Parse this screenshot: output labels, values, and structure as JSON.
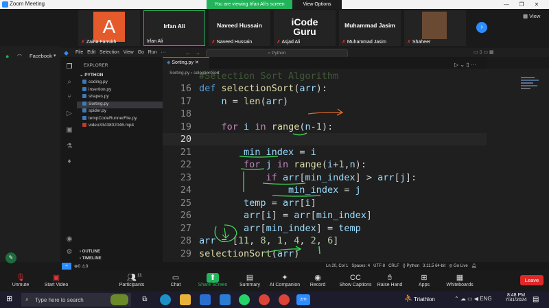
{
  "zoom": {
    "title": "Zoom Meeting",
    "share_banner": "You are viewing Irfan Ali's screen",
    "view_options": "View Options",
    "view_label": "View",
    "participants_strip": [
      {
        "tile_name": "",
        "caption": "Zaina Farrukh",
        "initial": "A",
        "muted": true
      },
      {
        "tile_name": "Irfan Ali",
        "caption": "Irfan Ali",
        "muted": false
      },
      {
        "tile_name": "Naveed Hussain",
        "caption": "Naveed Hussain",
        "muted": true
      },
      {
        "tile_name": "iCode Guru",
        "caption": "Asjad Ali",
        "muted": true
      },
      {
        "tile_name": "Muhammad Jasim",
        "caption": "Muhammad Jasim",
        "muted": true
      },
      {
        "tile_name": "",
        "caption": "Shaheer",
        "muted": true
      }
    ],
    "left_panel": {
      "profile": "Facebook"
    },
    "toolbar": [
      {
        "icon": "mic-off-icon",
        "label": "Unmute"
      },
      {
        "icon": "video-off-icon",
        "label": "Start Video"
      },
      {
        "icon": "participants-icon",
        "label": "Participants",
        "count": "11"
      },
      {
        "icon": "chat-icon",
        "label": "Chat"
      },
      {
        "icon": "share-screen-icon",
        "label": "Share Screen"
      },
      {
        "icon": "summary-icon",
        "label": "Summary"
      },
      {
        "icon": "ai-companion-icon",
        "label": "AI Companion"
      },
      {
        "icon": "record-icon",
        "label": "Record"
      },
      {
        "icon": "captions-icon",
        "label": "Show Captions"
      },
      {
        "icon": "raise-hand-icon",
        "label": "Raise Hand"
      },
      {
        "icon": "apps-icon",
        "label": "Apps"
      },
      {
        "icon": "whiteboard-icon",
        "label": "Whiteboards"
      }
    ],
    "leave": "Leave",
    "accent": "#23b35a"
  },
  "vscode": {
    "menu": [
      "File",
      "Edit",
      "Selection",
      "View",
      "Go",
      "Run",
      "···"
    ],
    "search_placeholder": "Python",
    "explorer_title": "EXPLORER",
    "folder": "PYTHON",
    "files": [
      {
        "name": "coding.py",
        "active": false
      },
      {
        "name": "insertion.py",
        "active": false
      },
      {
        "name": "shapes.py",
        "active": false
      },
      {
        "name": "Sorting.py",
        "active": true
      },
      {
        "name": "spider.py",
        "active": false
      },
      {
        "name": "tempCodeRunnerFile.py",
        "active": false
      },
      {
        "name": "video3343802046.mp4",
        "active": false
      }
    ],
    "outline": "OUTLINE",
    "timeline": "TIMELINE",
    "tab": "Sorting.py",
    "breadcrumb": [
      "Sorting.py",
      "selectionSort"
    ],
    "status": {
      "errors": "0",
      "warnings": "0",
      "position": "Ln 20, Col 1",
      "spaces": "Spaces: 4",
      "encoding": "UTF-8",
      "eol": "CRLF",
      "language": "Python",
      "version": "3.11.5 64-bit",
      "golive": "Go Live"
    },
    "code": [
      {
        "n": "16",
        "t": "def selectionSort(arr):"
      },
      {
        "n": "17",
        "t": "    n = len(arr)"
      },
      {
        "n": "18",
        "t": ""
      },
      {
        "n": "19",
        "t": "    for i in range(n-1):"
      },
      {
        "n": "20",
        "t": ""
      },
      {
        "n": "21",
        "t": "        min_index = i"
      },
      {
        "n": "22",
        "t": "        for j in range(i+1,n):"
      },
      {
        "n": "23",
        "t": "            if arr[min_index] > arr[j]:"
      },
      {
        "n": "24",
        "t": "                min_index = j"
      },
      {
        "n": "25",
        "t": "        temp = arr[i]"
      },
      {
        "n": "26",
        "t": "        arr[i] = arr[min_index]"
      },
      {
        "n": "27",
        "t": "        arr[min_index] = temp"
      },
      {
        "n": "28",
        "t": "arr = [11, 8, 1, 4, 2, 6]"
      },
      {
        "n": "29",
        "t": "selectionSort(arr)"
      }
    ],
    "top_partial": "#Selection Sort Algorithm"
  },
  "taskbar": {
    "search_placeholder": "Type here to search",
    "weather": "Triathlon",
    "time": "8:48 PM",
    "date": "7/31/2024"
  }
}
